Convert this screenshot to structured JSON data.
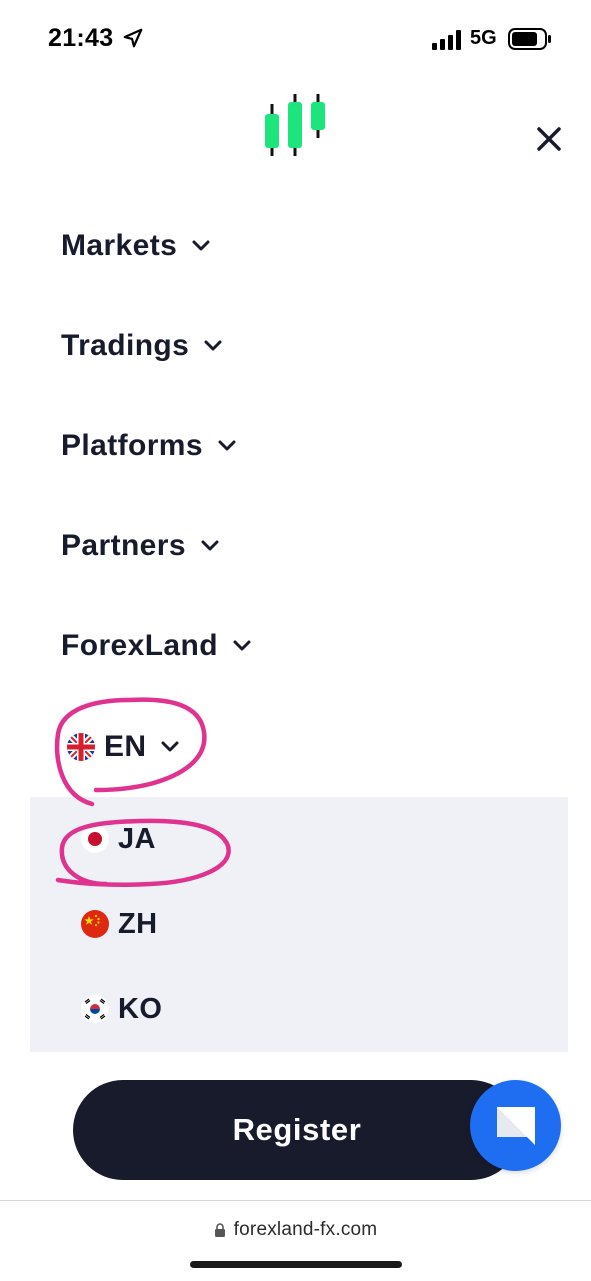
{
  "status_bar": {
    "time": "21:43",
    "network": "5G"
  },
  "menu": {
    "items": [
      {
        "label": "Markets"
      },
      {
        "label": "Tradings"
      },
      {
        "label": "Platforms"
      },
      {
        "label": "Partners"
      },
      {
        "label": "ForexLand"
      }
    ]
  },
  "language": {
    "current": "EN",
    "options": [
      {
        "code": "JA"
      },
      {
        "code": "ZH"
      },
      {
        "code": "KO"
      }
    ]
  },
  "register": {
    "label": "Register"
  },
  "browser": {
    "url": "forexland-fx.com"
  },
  "colors": {
    "brand_green": "#1de57e",
    "dark": "#171b2c",
    "chat_blue": "#1f6ef2",
    "annotation": "#e0338f"
  }
}
